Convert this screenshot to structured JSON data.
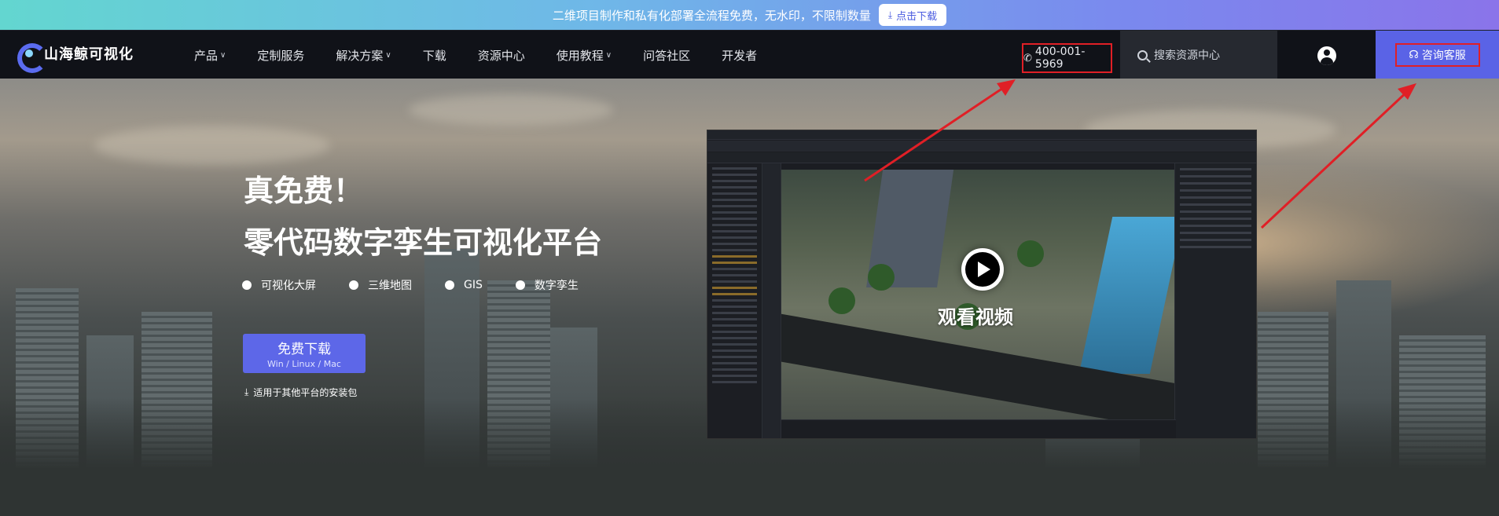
{
  "promo": {
    "text": "二维项目制作和私有化部署全流程免费，无水印，不限制数量",
    "button_label": "点击下载",
    "button_icon": "download-icon"
  },
  "nav": {
    "logo_text": "山海鲸可视化",
    "menu": [
      {
        "label": "产品",
        "dropdown": true
      },
      {
        "label": "定制服务",
        "dropdown": false
      },
      {
        "label": "解决方案",
        "dropdown": true
      },
      {
        "label": "下载",
        "dropdown": false
      },
      {
        "label": "资源中心",
        "dropdown": false
      },
      {
        "label": "使用教程",
        "dropdown": true
      },
      {
        "label": "问答社区",
        "dropdown": false
      },
      {
        "label": "开发者",
        "dropdown": false
      }
    ],
    "phone": "400-001-5969",
    "search_placeholder": "搜索资源中心",
    "consult_label": "咨询客服"
  },
  "hero": {
    "title": "真免费！",
    "subtitle": "零代码数字孪生可视化平台",
    "tags": [
      "可视化大屏",
      "三维地图",
      "GIS",
      "数字孪生"
    ],
    "download_label": "免费下载",
    "download_platforms": "Win / Linux / Mac",
    "other_platforms": "适用于其他平台的安装包",
    "video_label": "观看视频"
  },
  "colors": {
    "accent": "#5d67e8",
    "annotation_red": "#e01f26"
  }
}
